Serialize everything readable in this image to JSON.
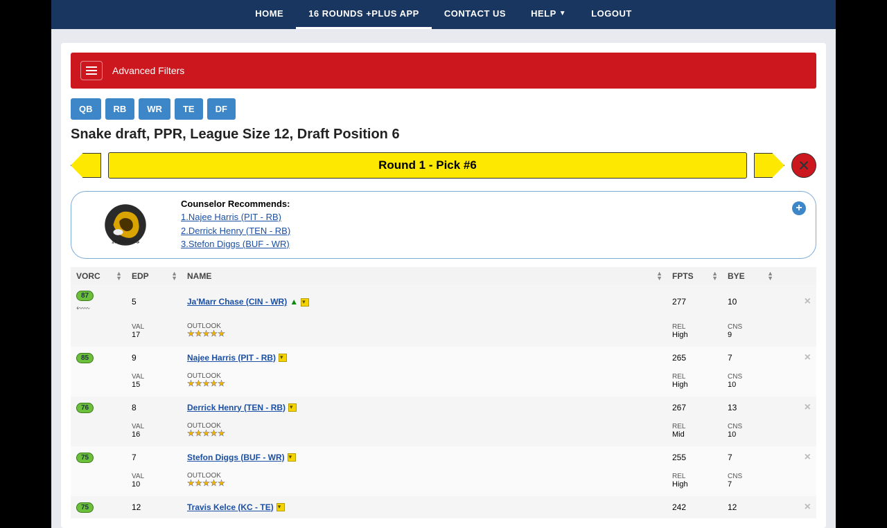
{
  "nav": {
    "home": "HOME",
    "app": "16 ROUNDS +PLUS APP",
    "contact": "CONTACT US",
    "help": "HELP",
    "logout": "LOGOUT"
  },
  "filters": {
    "label": "Advanced Filters"
  },
  "positions": {
    "qb": "QB",
    "rb": "RB",
    "wr": "WR",
    "te": "TE",
    "df": "DF"
  },
  "draft_title": "Snake draft, PPR, League Size 12, Draft Position 6",
  "round_label": "Round 1 - Pick #6",
  "recommend": {
    "title": "Counselor Recommends:",
    "r1": "1.Najee Harris (PIT - RB)",
    "r2": "2.Derrick Henry (TEN - RB)",
    "r3": "3.Stefon Diggs (BUF - WR)"
  },
  "logo_text": "16 ROUNDS",
  "logo_sub": "DRAFT·SOLUTION",
  "columns": {
    "vorc": "VORC",
    "edp": "EDP",
    "name": "NAME",
    "fpts": "FPTS",
    "bye": "BYE"
  },
  "sublabels": {
    "val": "VAL",
    "outlook": "OUTLOOK",
    "rel": "REL",
    "cns": "CNS"
  },
  "players": [
    {
      "vorc": "87",
      "edp": "5",
      "name": "Ja'Marr Chase (CIN - WR)",
      "fpts": "277",
      "bye": "10",
      "trend_up": true,
      "gun": true,
      "val": "17",
      "rel": "High",
      "cns": "9",
      "stars": 5
    },
    {
      "vorc": "85",
      "edp": "9",
      "name": "Najee Harris (PIT - RB)",
      "fpts": "265",
      "bye": "7",
      "trend_up": false,
      "gun": false,
      "val": "15",
      "rel": "High",
      "cns": "10",
      "stars": 5
    },
    {
      "vorc": "76",
      "edp": "8",
      "name": "Derrick Henry (TEN - RB)",
      "fpts": "267",
      "bye": "13",
      "trend_up": false,
      "gun": false,
      "val": "16",
      "rel": "Mid",
      "cns": "10",
      "stars": 5
    },
    {
      "vorc": "75",
      "edp": "7",
      "name": "Stefon Diggs (BUF - WR)",
      "fpts": "255",
      "bye": "7",
      "trend_up": false,
      "gun": false,
      "val": "10",
      "rel": "High",
      "cns": "7",
      "stars": 5
    },
    {
      "vorc": "75",
      "edp": "12",
      "name": "Travis Kelce (KC - TE)",
      "fpts": "242",
      "bye": "12",
      "trend_up": false,
      "gun": false,
      "val": "",
      "rel": "",
      "cns": "",
      "stars": 0
    }
  ]
}
